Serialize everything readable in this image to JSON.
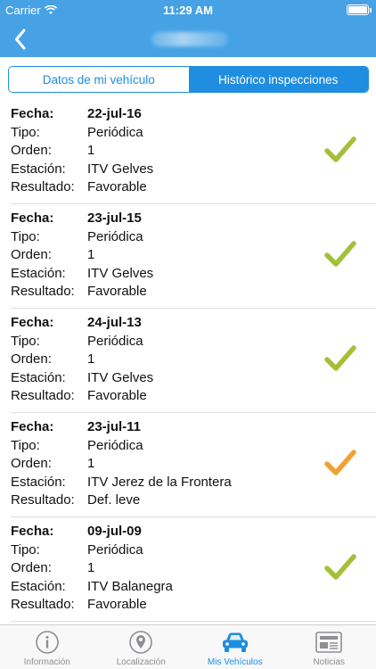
{
  "status_bar": {
    "carrier": "Carrier",
    "time": "11:29 AM"
  },
  "nav": {
    "back_icon": "chevron-left-icon"
  },
  "segments": [
    {
      "label": "Datos de mi vehículo",
      "active": false
    },
    {
      "label": "Histórico inspecciones",
      "active": true
    }
  ],
  "labels": {
    "fecha": "Fecha:",
    "tipo": "Tipo:",
    "orden": "Orden:",
    "estacion": "Estación:",
    "resultado": "Resultado:"
  },
  "inspections": [
    {
      "fecha": "22-jul-16",
      "tipo": "Periódica",
      "orden": "1",
      "estacion": "ITV Gelves",
      "resultado": "Favorable",
      "check_color": "#a4c038"
    },
    {
      "fecha": "23-jul-15",
      "tipo": "Periódica",
      "orden": "1",
      "estacion": "ITV Gelves",
      "resultado": "Favorable",
      "check_color": "#a4c038"
    },
    {
      "fecha": "24-jul-13",
      "tipo": "Periódica",
      "orden": "1",
      "estacion": "ITV Gelves",
      "resultado": "Favorable",
      "check_color": "#a4c038"
    },
    {
      "fecha": "23-jul-11",
      "tipo": "Periódica",
      "orden": "1",
      "estacion": "ITV Jerez de la Frontera",
      "resultado": "Def. leve",
      "check_color": "#f2a033"
    },
    {
      "fecha": "09-jul-09",
      "tipo": "Periódica",
      "orden": "1",
      "estacion": "ITV Balanegra",
      "resultado": "Favorable",
      "check_color": "#a4c038"
    }
  ],
  "tabs": [
    {
      "label": "Información",
      "icon": "info-icon",
      "active": false
    },
    {
      "label": "Localización",
      "icon": "map-pin-icon",
      "active": false
    },
    {
      "label": "Mis Vehículos",
      "icon": "car-icon",
      "active": true
    },
    {
      "label": "Noticias",
      "icon": "newspaper-icon",
      "active": false
    }
  ],
  "colors": {
    "primary": "#46a2e5",
    "accent": "#1f8de0",
    "ok": "#a4c038",
    "warning": "#f2a033"
  }
}
